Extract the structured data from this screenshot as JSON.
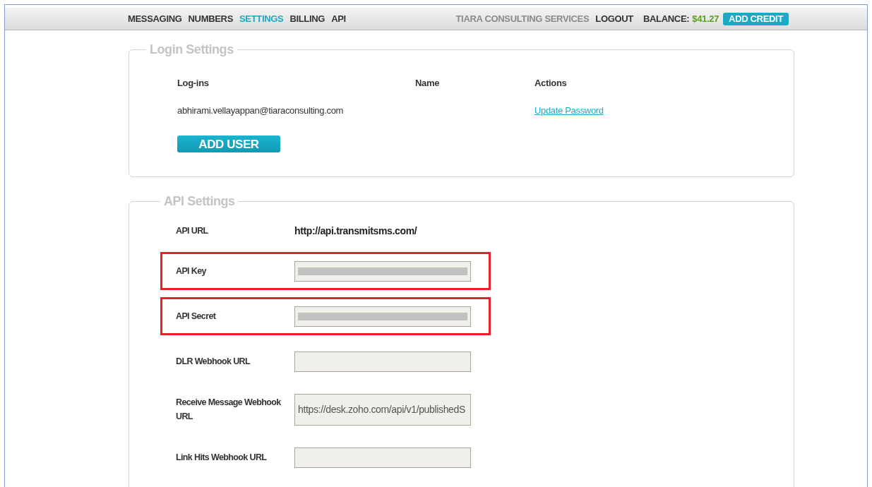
{
  "nav": {
    "items": [
      {
        "label": "MESSAGING",
        "selected": false
      },
      {
        "label": "NUMBERS",
        "selected": false
      },
      {
        "label": "SETTINGS",
        "selected": true
      },
      {
        "label": "BILLING",
        "selected": false
      },
      {
        "label": "API",
        "selected": false
      }
    ],
    "account": "TIARA CONSULTING SERVICES",
    "logout": "LOGOUT",
    "balance_label": "BALANCE:",
    "balance": "$41.27",
    "add_credit": "ADD CREDIT"
  },
  "login_settings": {
    "title": "Login Settings",
    "columns": [
      "Log-ins",
      "Name",
      "Actions"
    ],
    "rows": [
      {
        "login": "abhirami.vellayappan@tiaraconsulting.com",
        "action": "Update Password"
      }
    ],
    "add_user": "ADD USER"
  },
  "api_settings": {
    "title": "API Settings",
    "rows": [
      {
        "kind": "text",
        "label": "API URL",
        "value": "http://api.transmitsms.com/"
      },
      {
        "kind": "field",
        "label": "API Key",
        "redacted": true,
        "highlighted": true
      },
      {
        "kind": "field",
        "label": "API Secret",
        "redacted": true,
        "highlighted": true
      },
      {
        "kind": "field",
        "label": "DLR Webhook URL",
        "redacted": false,
        "highlighted": false
      },
      {
        "kind": "field",
        "label": "Receive Message Webhook URL",
        "value": "https://desk.zoho.com/api/v1/publishedS",
        "redacted": false,
        "highlighted": false
      },
      {
        "kind": "field",
        "label": "Link Hits Webhook URL",
        "redacted": false,
        "highlighted": false
      }
    ]
  }
}
